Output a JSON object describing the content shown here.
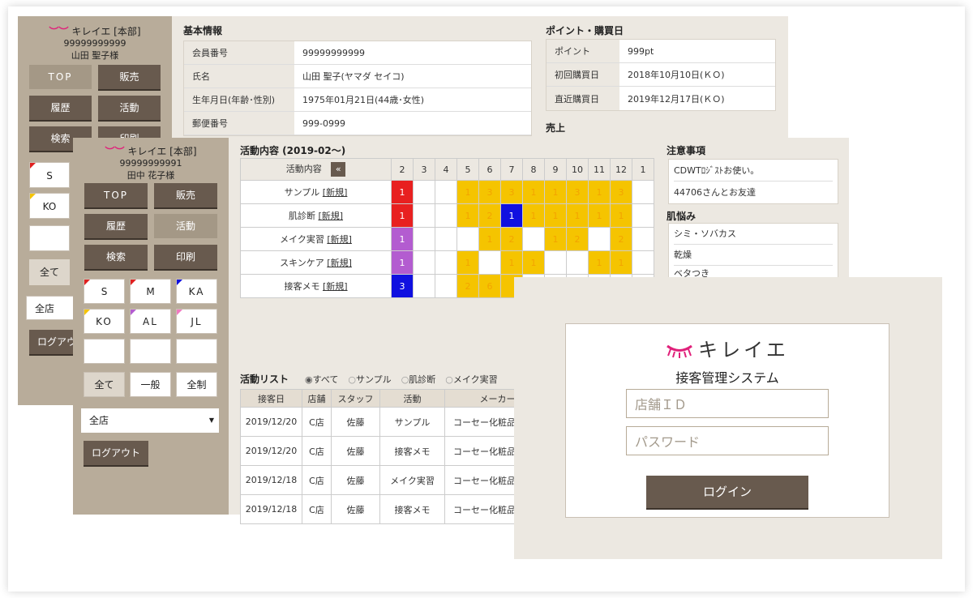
{
  "brand": {
    "name": "キレイエ",
    "store_tag": "[本部]"
  },
  "customer1": {
    "id": "99999999999",
    "name": "山田 聖子様"
  },
  "customer2": {
    "id": "99999999991",
    "name": "田中 花子様"
  },
  "nav": {
    "top": "TOP",
    "sales": "販売",
    "history": "履歴",
    "activity": "活動",
    "search": "検索",
    "print": "印刷"
  },
  "tags": {
    "s": "S",
    "m": "M",
    "ka": "KA",
    "ko": "KO",
    "al": "AL",
    "jl": "JL"
  },
  "filters": {
    "all": "全て",
    "general": "一般",
    "full": "全制"
  },
  "store_select": "全店",
  "logout": "ログアウト",
  "colors": {
    "sidebar": "#b8ac9a",
    "button_dark": "#685a4e",
    "panel": "#ece8e1",
    "yellow": "#f5c400",
    "red": "#e82020",
    "blue": "#1010e0",
    "purple": "#b35cd0",
    "brand_pink": "#e0207a"
  },
  "basic_info": {
    "title": "基本情報",
    "rows": [
      {
        "k": "会員番号",
        "v": "99999999999"
      },
      {
        "k": "氏名",
        "v": "山田 聖子(ヤマダ セイコ)"
      },
      {
        "k": "生年月日(年齢･性別)",
        "v": "1975年01月21日(44歳･女性)"
      },
      {
        "k": "郵便番号",
        "v": "999-0999"
      }
    ]
  },
  "points": {
    "title": "ポイント・購買日",
    "rows": [
      {
        "k": "ポイント",
        "v": "999pt"
      },
      {
        "k": "初回購買日",
        "v": "2018年10月10日(ＫＯ)"
      },
      {
        "k": "直近購買日",
        "v": "2019年12月17日(ＫＯ)"
      }
    ],
    "sales_title": "売上"
  },
  "activity": {
    "title": "活動内容 (2019-02～)",
    "header_label": "活動内容",
    "collapse": "«",
    "months": [
      "2",
      "3",
      "4",
      "5",
      "6",
      "7",
      "8",
      "9",
      "10",
      "11",
      "12",
      "1"
    ],
    "new_link": "[新規]",
    "rows": [
      {
        "label": "サンプル",
        "cells": [
          "r1",
          "",
          "",
          "y1",
          "y3",
          "y3",
          "y1",
          "y1",
          "y3",
          "y1",
          "y3",
          ""
        ]
      },
      {
        "label": "肌診断",
        "cells": [
          "r1",
          "",
          "",
          "y1",
          "y2",
          "b1",
          "y1",
          "y1",
          "y1",
          "y1",
          "y1",
          ""
        ]
      },
      {
        "label": "メイク実習",
        "cells": [
          "p1",
          "",
          "",
          "",
          "y1",
          "y2",
          "",
          "y1",
          "y2",
          "",
          "y2",
          ""
        ]
      },
      {
        "label": "スキンケア",
        "cells": [
          "p1",
          "",
          "",
          "y1",
          "",
          "y1",
          "y1",
          "",
          "",
          "y1",
          "y1",
          ""
        ]
      },
      {
        "label": "接客メモ",
        "cells": [
          "b3",
          "",
          "",
          "y2",
          "y6",
          "y",
          "",
          "",
          "",
          "",
          "",
          ""
        ]
      }
    ]
  },
  "notes": {
    "title": "注意事項",
    "items": [
      "CDWTﾛｼﾞｽﾄお使い。",
      "44706さんとお友達"
    ]
  },
  "concerns": {
    "title": "肌悩み",
    "items": [
      "シミ・ソバカス",
      "乾燥",
      "ベタつき"
    ]
  },
  "activity_list": {
    "title": "活動リスト",
    "radios": [
      "すべて",
      "サンプル",
      "肌診断",
      "メイク実習"
    ],
    "headers": [
      "接客日",
      "店舗",
      "スタッフ",
      "活動",
      "メーカー"
    ],
    "rows": [
      [
        "2019/12/20",
        "C店",
        "佐藤",
        "サンプル",
        "コーセー化粧品"
      ],
      [
        "2019/12/20",
        "C店",
        "佐藤",
        "接客メモ",
        "コーセー化粧品"
      ],
      [
        "2019/12/18",
        "C店",
        "佐藤",
        "メイク実習",
        "コーセー化粧品"
      ],
      [
        "2019/12/18",
        "C店",
        "佐藤",
        "接客メモ",
        "コーセー化粧品"
      ]
    ]
  },
  "login": {
    "system_name": "接客管理システム",
    "store_id_placeholder": "店舗ＩＤ",
    "password_placeholder": "パスワード",
    "button": "ログイン"
  }
}
